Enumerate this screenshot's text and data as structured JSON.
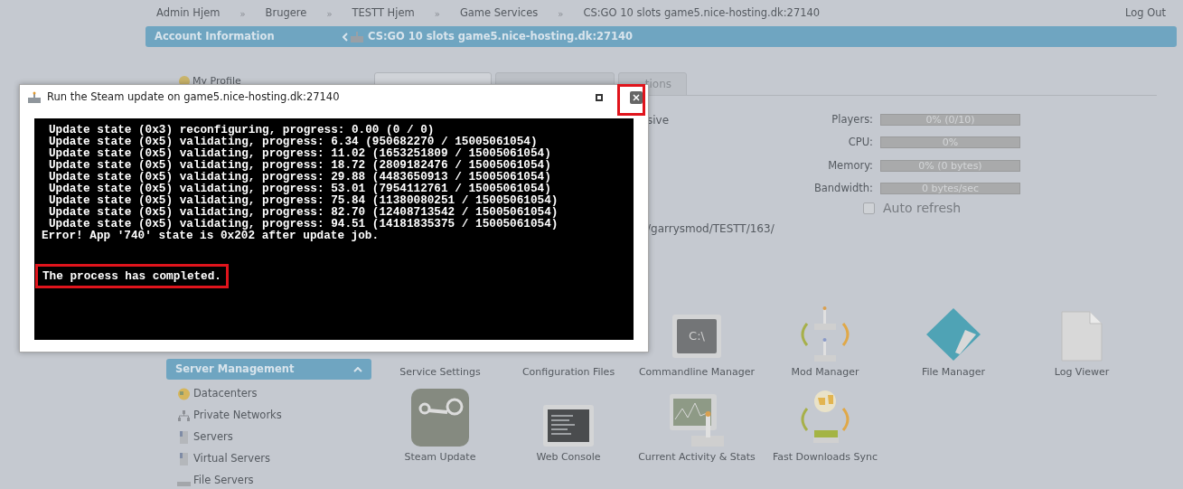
{
  "breadcrumbs": [
    "Admin Hjem",
    "Brugere",
    "TESTT Hjem",
    "Game Services",
    "CS:GO 10 slots game5.nice-hosting.dk:27140"
  ],
  "breadcrumb_separator": "»",
  "logout": "Log Out",
  "header": {
    "section": "Account Information",
    "server": "CS:GO 10 slots game5.nice-hosting.dk:27140"
  },
  "sidebar_top": {
    "label": "My Profile"
  },
  "tabs": [
    {
      "selected": true
    },
    {
      "selected": false
    },
    {
      "label": "tions",
      "selected": false
    }
  ],
  "info": {
    "fragment_1": "sive",
    "fragment_2": "/garrysmod/TESTT/163/"
  },
  "stats": [
    {
      "label": "Players:",
      "reading": "0% (0/10)",
      "level": 0
    },
    {
      "label": "CPU:",
      "reading": "0%",
      "level": 0
    },
    {
      "label": "Memory:",
      "reading": "0% (0 bytes)",
      "level": 0
    },
    {
      "label": "Bandwidth:",
      "reading": "0 bytes/sec",
      "level": 0
    }
  ],
  "auto_refresh": {
    "label": "Auto refresh",
    "checked": false
  },
  "server_management": {
    "title": "Server Management",
    "expanded": true,
    "items": [
      {
        "label": "Datacenters",
        "kind": "datacenter"
      },
      {
        "label": "Private Networks",
        "kind": "network"
      },
      {
        "label": "Servers",
        "kind": "server"
      },
      {
        "label": "Virtual Servers",
        "kind": "server"
      },
      {
        "label": "File Servers",
        "kind": "fileserver"
      }
    ]
  },
  "tools": [
    {
      "label": "Service Settings",
      "kind": "hidden"
    },
    {
      "label": "Configuration Files",
      "kind": "hidden"
    },
    {
      "label": "Commandline Manager",
      "kind": "cmd",
      "icon_text": "C:\\"
    },
    {
      "label": "Mod Manager",
      "kind": "mod"
    },
    {
      "label": "File Manager",
      "kind": "folder"
    },
    {
      "label": "Log Viewer",
      "kind": "log"
    },
    {
      "label": "Steam Update",
      "kind": "steam"
    },
    {
      "label": "Web Console",
      "kind": "console"
    },
    {
      "label": "Current Activity & Stats",
      "kind": "activity"
    },
    {
      "label": "Fast Downloads Sync",
      "kind": "sync"
    }
  ],
  "dialog": {
    "title": "Run the Steam update on game5.nice-hosting.dk:27140",
    "output": [
      {
        "kind": "progress",
        "text": "Update state (0x3) reconfiguring, progress: 0.00 (0 / 0)"
      },
      {
        "kind": "progress",
        "text": "Update state (0x5) validating, progress: 6.34 (950682270 / 15005061054)"
      },
      {
        "kind": "progress",
        "text": "Update state (0x5) validating, progress: 11.02 (1653251809 / 15005061054)"
      },
      {
        "kind": "progress",
        "text": "Update state (0x5) validating, progress: 18.72 (2809182476 / 15005061054)"
      },
      {
        "kind": "progress",
        "text": "Update state (0x5) validating, progress: 29.88 (4483650913 / 15005061054)"
      },
      {
        "kind": "progress",
        "text": "Update state (0x5) validating, progress: 53.01 (7954112761 / 15005061054)"
      },
      {
        "kind": "progress",
        "text": "Update state (0x5) validating, progress: 75.84 (11380080251 / 15005061054)"
      },
      {
        "kind": "progress",
        "text": "Update state (0x5) validating, progress: 82.70 (12408713542 / 15005061054)"
      },
      {
        "kind": "progress",
        "text": "Update state (0x5) validating, progress: 94.51 (14181835375 / 15005061054)"
      },
      {
        "kind": "error",
        "text": "Error! App '740' state is 0x202 after update job."
      },
      {
        "kind": "blank"
      },
      {
        "kind": "status",
        "text": "The process has completed."
      }
    ]
  }
}
